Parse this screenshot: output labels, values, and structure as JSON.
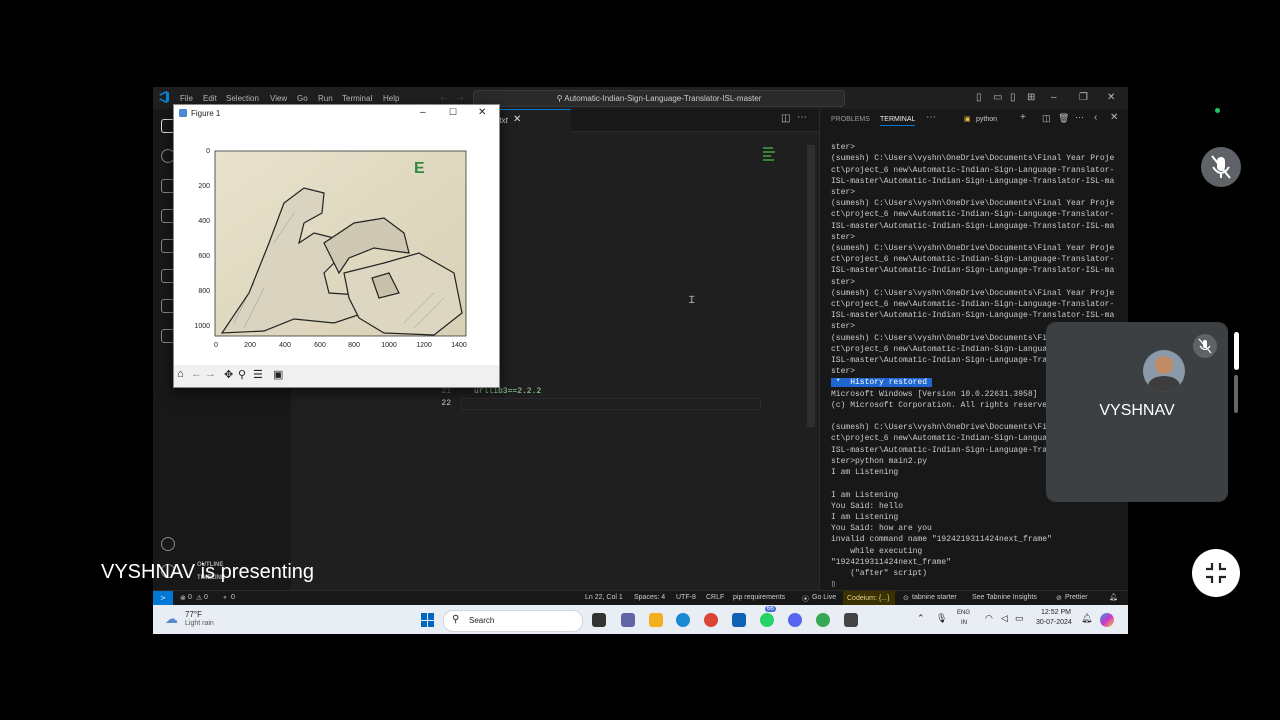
{
  "vscode": {
    "menu": [
      "File",
      "Edit",
      "Selection",
      "View",
      "Go",
      "Run",
      "Terminal",
      "Help"
    ],
    "search_text": "Automatic-Indian-Sign-Language-Translator-ISL-master",
    "tab_label": ".txt",
    "code_lines": [
      {
        "num": "21",
        "text": "urllib3==2.2.2"
      },
      {
        "num": "22",
        "text": ""
      }
    ],
    "sidebar_bottom_labels": [
      "OUTLINE",
      "TIMELINE"
    ]
  },
  "panel": {
    "tabs": [
      "PROBLEMS",
      "TERMINAL"
    ],
    "shell_label": "python",
    "terminal_lines": [
      "ster>",
      "(sumesh) C:\\Users\\vyshn\\OneDrive\\Documents\\Final Year Proje",
      "ct\\project_6 new\\Automatic-Indian-Sign-Language-Translator-",
      "ISL-master\\Automatic-Indian-Sign-Language-Translator-ISL-ma",
      "ster>",
      "(sumesh) C:\\Users\\vyshn\\OneDrive\\Documents\\Final Year Proje",
      "ct\\project_6 new\\Automatic-Indian-Sign-Language-Translator-",
      "ISL-master\\Automatic-Indian-Sign-Language-Translator-ISL-ma",
      "ster>",
      "(sumesh) C:\\Users\\vyshn\\OneDrive\\Documents\\Final Year Proje",
      "ct\\project_6 new\\Automatic-Indian-Sign-Language-Translator-",
      "ISL-master\\Automatic-Indian-Sign-Language-Translator-ISL-ma",
      "ster>",
      "(sumesh) C:\\Users\\vyshn\\OneDrive\\Documents\\Final Year Proje",
      "ct\\project_6 new\\Automatic-Indian-Sign-Language-Translator-",
      "ISL-master\\Automatic-Indian-Sign-Language-Translator-ISL-ma",
      "ster>",
      "(sumesh) C:\\Users\\vyshn\\OneDrive\\Documents\\Final Year Proje",
      "ct\\project_6 new\\Automatic-Indian-Sign-Language-Translator-",
      "ISL-master\\Automatic-Indian-Sign-Language-Translator-ISL-ma",
      "ster>"
    ],
    "history_restored": " *  History restored ",
    "terminal_lines_2": [
      "Microsoft Windows [Version 10.0.22631.3958]",
      "(c) Microsoft Corporation. All rights reserved.",
      "",
      "(sumesh) C:\\Users\\vyshn\\OneDrive\\Documents\\Final Year Proje",
      "ct\\project_6 new\\Automatic-Indian-Sign-Language-Translator-",
      "ISL-master\\Automatic-Indian-Sign-Language-Translator-ISL-ma",
      "ster>python main2.py",
      "I am Listening",
      "",
      "I am Listening",
      "You Said: hello",
      "I am Listening",
      "You Said: how are you",
      "invalid command name \"1924219311424next_frame\"",
      "    while executing",
      "\"1924219311424next_frame\"",
      "    (\"after\" script)"
    ]
  },
  "statusbar": {
    "errors": "0",
    "warnings": "0",
    "ports": "0",
    "position": "Ln 22, Col 1",
    "spaces": "Spaces: 4",
    "encoding": "UTF-8",
    "eol": "CRLF",
    "language": "pip requirements",
    "golive": "Go Live",
    "codeium": "Codeium: {...}",
    "tabnine": "tabnine starter",
    "tabnine_insights": "See Tabnine Insights",
    "prettier": "Prettier"
  },
  "taskbar": {
    "weather_temp": "77°F",
    "weather_desc": "Light rain",
    "search_label": "Search",
    "lang1": "ENG",
    "lang2": "IN",
    "time": "12:52 PM",
    "date": "30-07-2024",
    "notif_badge": "66"
  },
  "figure": {
    "title": "Figure 1",
    "predicted_letter": "E",
    "y_ticks": [
      "0",
      "200",
      "400",
      "600",
      "800",
      "1000"
    ],
    "x_ticks": [
      "0",
      "200",
      "400",
      "600",
      "800",
      "1000",
      "1200",
      "1400"
    ]
  },
  "meeting": {
    "tile_name": "VYSHNAV",
    "presenting_text": "VYSHNAV is presenting"
  },
  "colors": {
    "accent": "#0078d4",
    "history_highlight": "#1f66d1",
    "status_codeium": "#3a3000"
  }
}
